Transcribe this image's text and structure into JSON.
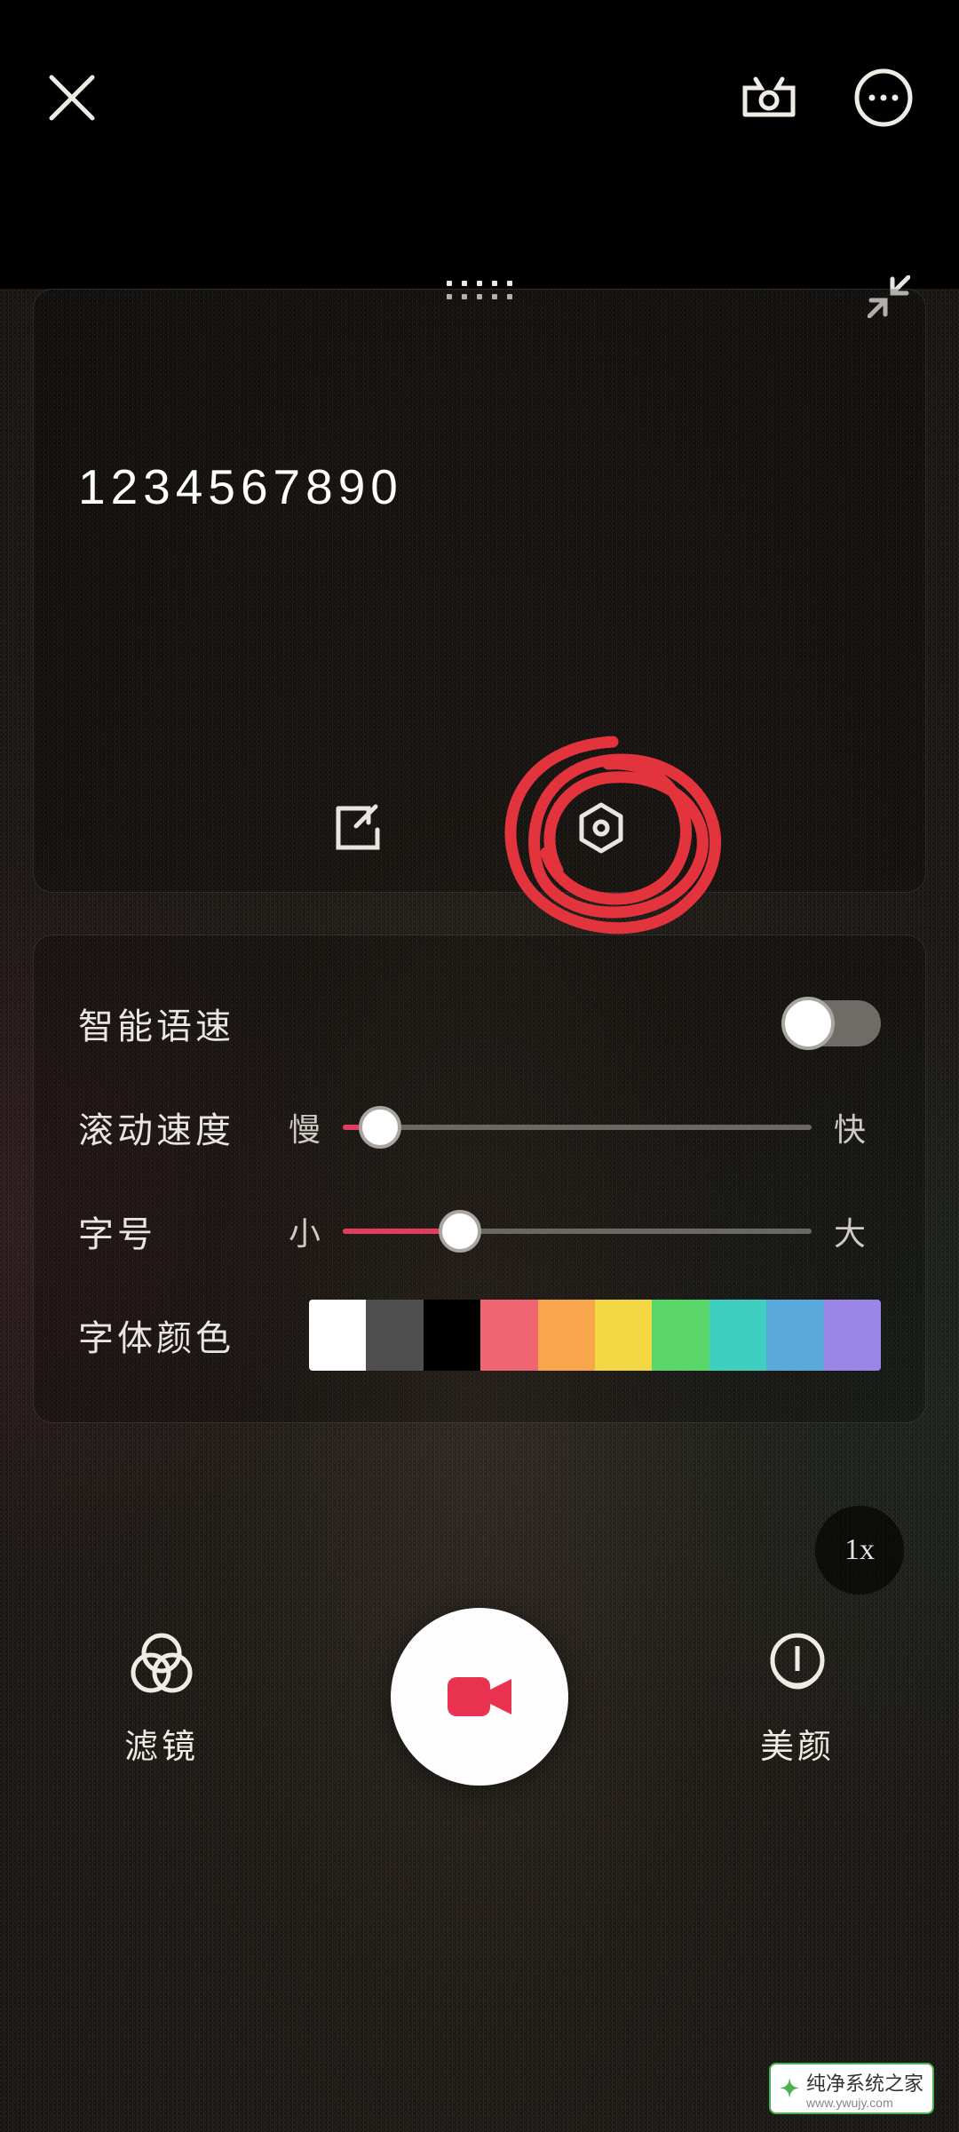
{
  "teleprompter": {
    "text": "1234567890"
  },
  "settings": {
    "smart_speed_label": "智能语速",
    "smart_speed_on": false,
    "scroll_speed": {
      "label": "滚动速度",
      "min_label": "慢",
      "max_label": "快",
      "value_pct": 8
    },
    "font_size": {
      "label": "字号",
      "min_label": "小",
      "max_label": "大",
      "value_pct": 25
    },
    "font_color_label": "字体颜色",
    "colors": [
      "#ffffff",
      "#4f4f4f",
      "#000000",
      "#ef6571",
      "#f7a64b",
      "#f4d744",
      "#5bd66a",
      "#3ecfc0",
      "#5aa9db",
      "#9a86e6"
    ]
  },
  "speed_badge": "1x",
  "bottom": {
    "filter_label": "滤镜",
    "beauty_label": "美颜"
  },
  "watermark": {
    "brand": "纯净系统之家",
    "url": "www.ywujy.com"
  }
}
